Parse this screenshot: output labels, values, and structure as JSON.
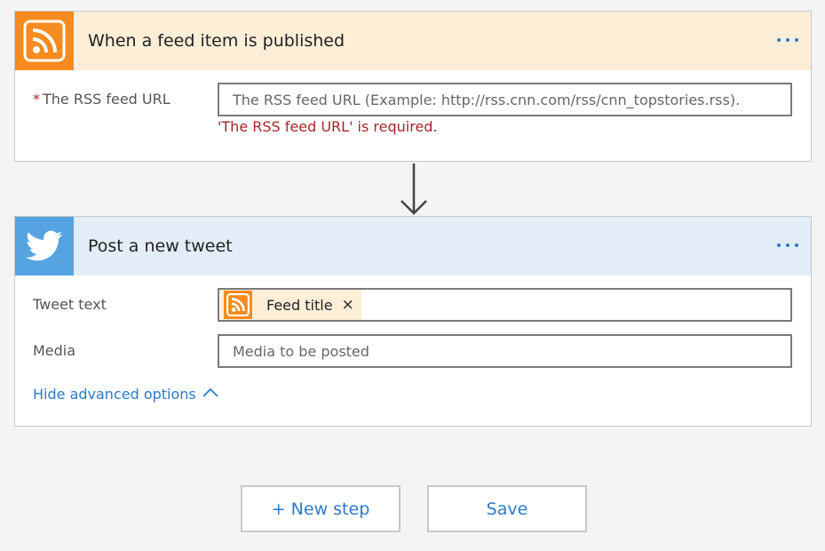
{
  "trigger": {
    "title": "When a feed item is published",
    "icon": "rss-icon",
    "header_color": "#fdeed8",
    "icon_bg": "#f68b1f",
    "required_mark": "*",
    "feed_url_label": "The RSS feed URL",
    "feed_url_placeholder": "The RSS feed URL (Example: http://rss.cnn.com/rss/cnn_topstories.rss).",
    "error": "'The RSS feed URL' is required."
  },
  "action": {
    "title": "Post a new tweet",
    "icon": "twitter-bird-icon",
    "header_color": "#e3edf7",
    "icon_bg": "#55a4e1",
    "tweet_label": "Tweet text",
    "tweet_token": "Feed title",
    "token_remove": "×",
    "media_label": "Media",
    "media_placeholder": "Media to be posted",
    "advanced_toggle": "Hide advanced options"
  },
  "footer": {
    "new_step": "+ New step",
    "save": "Save"
  }
}
